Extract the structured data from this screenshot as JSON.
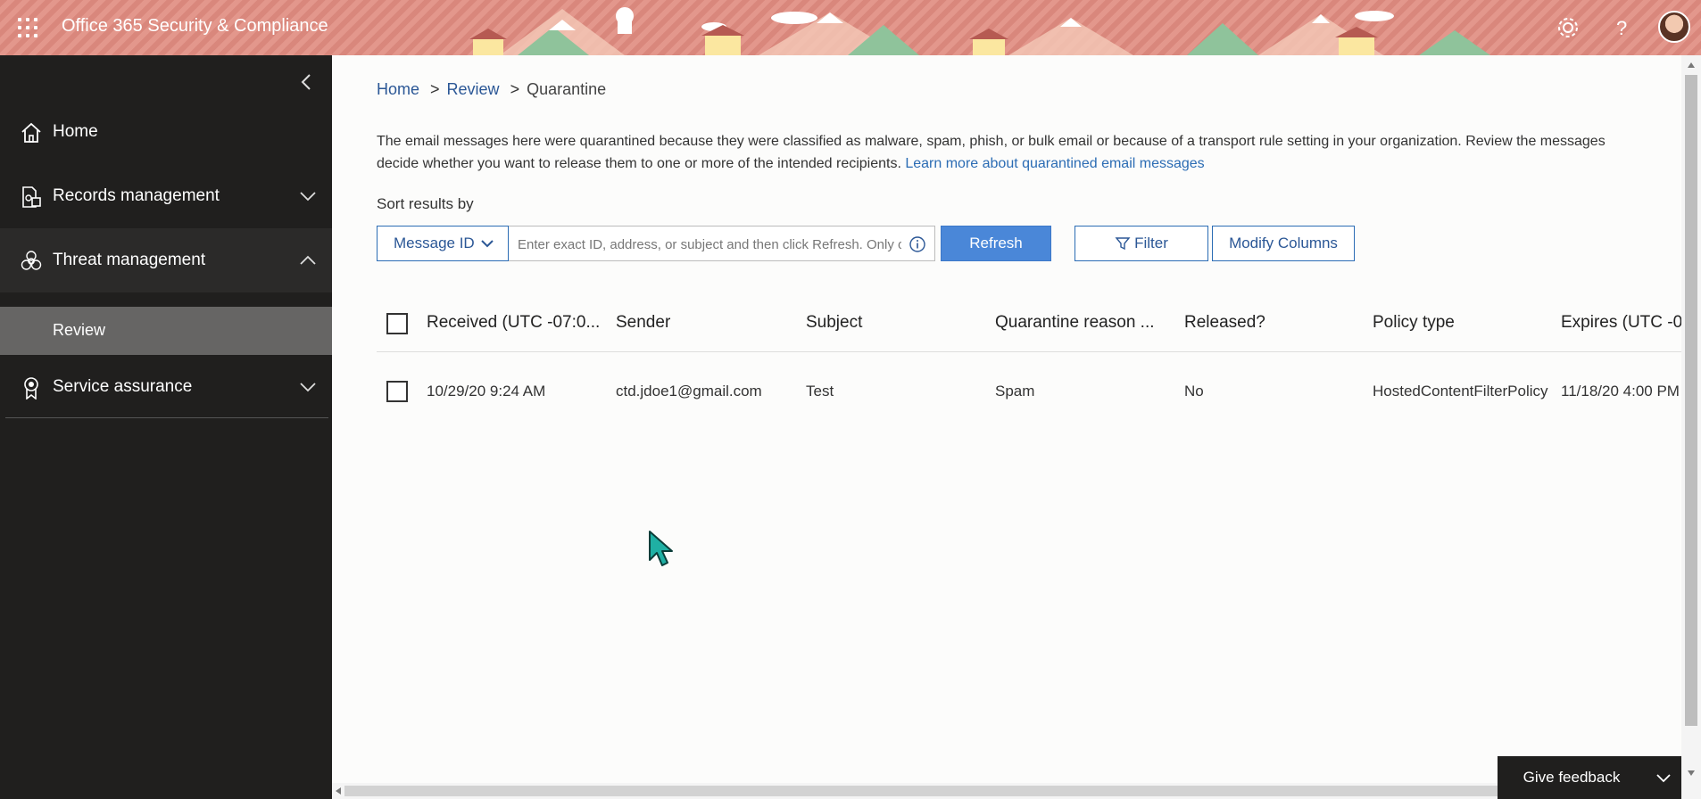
{
  "app": {
    "title": "Office 365 Security & Compliance"
  },
  "top_icons": [
    "waffle-icon",
    "gear-icon",
    "help-icon",
    "avatar"
  ],
  "sidebar": {
    "items": [
      {
        "label": "Home",
        "icon": "home-icon"
      },
      {
        "label": "Records management",
        "icon": "records-icon",
        "expanded": false
      },
      {
        "label": "Threat management",
        "icon": "biohazard-icon",
        "expanded": true
      },
      {
        "label": "Service assurance",
        "icon": "ribbon-icon",
        "expanded": false
      }
    ],
    "sub_items": [
      {
        "label": "Review",
        "selected": true
      }
    ]
  },
  "breadcrumb": {
    "home": "Home",
    "review": "Review",
    "current": "Quarantine",
    "separator": ">"
  },
  "description": {
    "line1": "The email messages here were quarantined because they were classified as malware, spam, phish, or bulk email or because of a transport rule setting in your organization. Review the messages",
    "line2": "decide whether you want to release them to one or more of the intended recipients.",
    "link": "Learn more about quarantined email messages"
  },
  "sort": {
    "label": "Sort results by",
    "selected": "Message ID",
    "placeholder": "Enter exact ID, address, or subject and then click Refresh. Only one"
  },
  "buttons": {
    "refresh": "Refresh",
    "filter": "Filter",
    "modify_columns": "Modify Columns"
  },
  "table": {
    "columns": [
      "Received (UTC -07:0...",
      "Sender",
      "Subject",
      "Quarantine reason ...",
      "Released?",
      "Policy type",
      "Expires (UTC -0"
    ],
    "rows": [
      [
        "10/29/20 9:24 AM",
        "ctd.jdoe1@gmail.com",
        "Test",
        "Spam",
        "No",
        "HostedContentFilterPolicy",
        "11/18/20 4:00 PM"
      ]
    ]
  },
  "feedback": {
    "label": "Give feedback"
  },
  "colors": {
    "accent": "#4a87d8",
    "link": "#2b6cb4",
    "sidebar_bg": "#201f1e",
    "topbar_bg": "#e3978c"
  }
}
